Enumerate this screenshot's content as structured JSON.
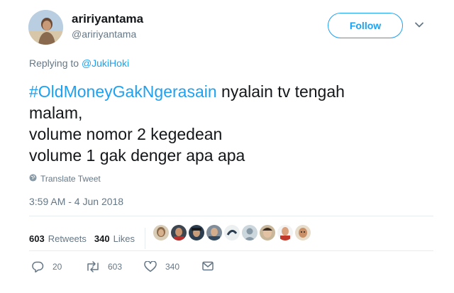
{
  "header": {
    "display_name": "aririyantama",
    "handle": "@aririyantama",
    "follow_label": "Follow"
  },
  "reply": {
    "prefix": "Replying to",
    "to": "@JukiHoki"
  },
  "tweet": {
    "hashtag": "#OldMoneyGakNgerasain",
    "line1_rest": " nyalain tv tengah",
    "line2": "malam,",
    "line3": "volume nomor 2 kegedean",
    "line4": "volume 1 gak denger apa apa"
  },
  "translate_label": "Translate Tweet",
  "timestamp": "3:59 AM - 4 Jun 2018",
  "stats": {
    "retweets_count": "603",
    "retweets_label": "Retweets",
    "likes_count": "340",
    "likes_label": "Likes"
  },
  "likers": [
    "avatar-1",
    "avatar-2",
    "avatar-3",
    "avatar-4",
    "avatar-5",
    "avatar-6",
    "avatar-7",
    "avatar-8",
    "avatar-9"
  ],
  "actions": {
    "reply_count": "20",
    "retweet_count": "603",
    "like_count": "340"
  },
  "colors": {
    "accent": "#1da1f2",
    "muted": "#657786",
    "retweet_green": "#17bf63"
  }
}
